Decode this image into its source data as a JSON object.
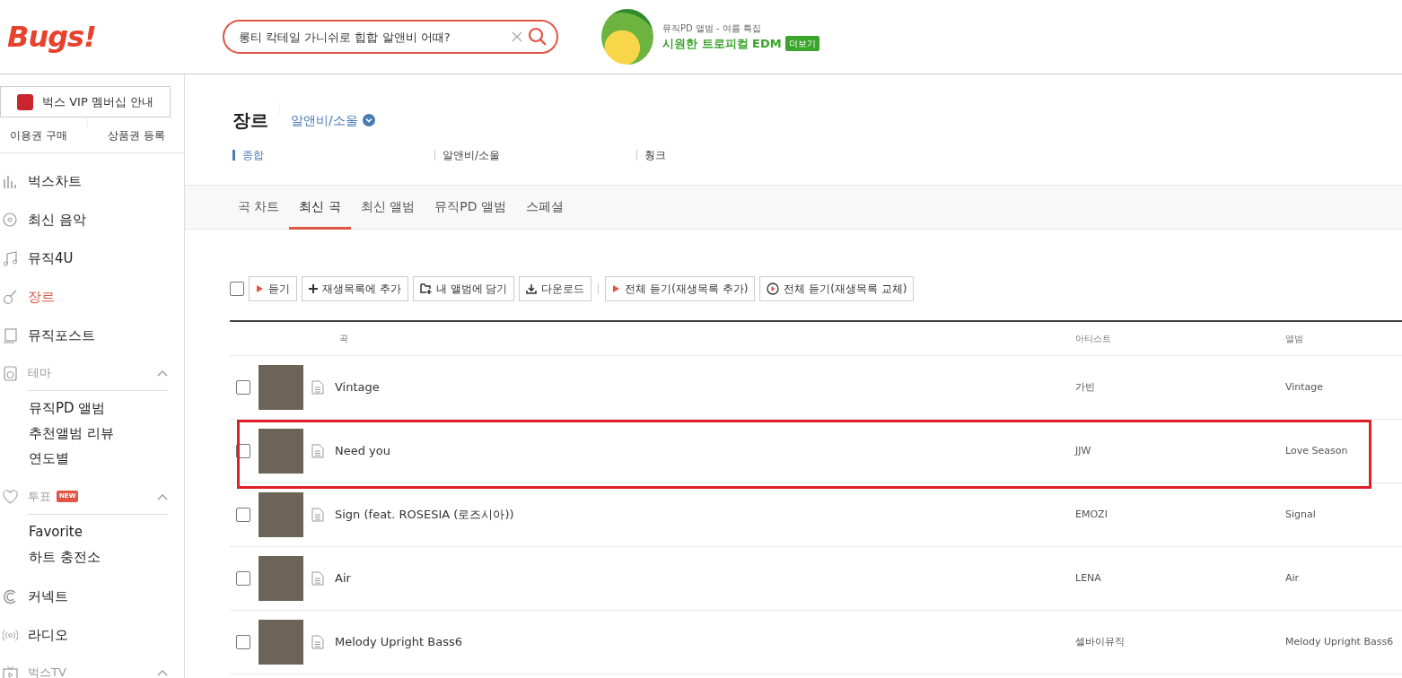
{
  "header": {
    "logo": "Bugs!",
    "search": {
      "placeholder": "롱티 칵테일 가니쉬로 힙합 알앤비 어때?"
    },
    "promo": {
      "caption": "뮤직PD 앨범 - 여름 특집",
      "title": "시원한 트로피컬 EDM",
      "more": "더보기"
    }
  },
  "sidebar": {
    "vip_button": "벅스 VIP 멤버십 안내",
    "links": [
      "이용권 구매",
      "상품권 등록"
    ],
    "items": [
      {
        "kind": "link",
        "label": "벅스차트",
        "selected": false
      },
      {
        "kind": "link",
        "label": "최신 음악",
        "selected": false
      },
      {
        "kind": "link",
        "label": "뮤직4U",
        "selected": false
      },
      {
        "kind": "link",
        "label": "장르",
        "selected": true
      },
      {
        "kind": "link",
        "label": "뮤직포스트",
        "selected": false
      },
      {
        "kind": "section",
        "label": "테마",
        "expanded": true,
        "children": [
          {
            "label": "뮤직PD 앨범"
          },
          {
            "label": "추천앨범 리뷰"
          },
          {
            "label": "연도별"
          }
        ]
      },
      {
        "kind": "section",
        "label": "투표",
        "badge": "NEW",
        "expanded": true,
        "children": [
          {
            "label": "Favorite"
          },
          {
            "label": "하트 충전소"
          }
        ]
      },
      {
        "kind": "link",
        "label": "커넥트",
        "selected": false
      },
      {
        "kind": "link",
        "label": "라디오",
        "selected": false
      },
      {
        "kind": "section",
        "label": "벅스TV",
        "expanded": true
      }
    ]
  },
  "page": {
    "title": "장르",
    "breadcrumb": "알앤비/소울",
    "genres": [
      {
        "label": "종합",
        "selected": true
      },
      {
        "label": "알앤비/소울",
        "selected": false
      },
      {
        "label": "훵크",
        "selected": false
      }
    ],
    "tabs": [
      {
        "label": "곡 차트",
        "selected": false
      },
      {
        "label": "최신 곡",
        "selected": true
      },
      {
        "label": "최신 앨범",
        "selected": false
      },
      {
        "label": "뮤직PD 앨범",
        "selected": false
      },
      {
        "label": "스페셜",
        "selected": false
      }
    ],
    "select_all": {
      "checked": false
    },
    "toolbar": [
      {
        "kind": "play",
        "label": "듣기"
      },
      {
        "kind": "add",
        "label": "재생목록에 추가"
      },
      {
        "kind": "album",
        "label": "내 앨범에 담기"
      },
      {
        "kind": "download",
        "label": "다운로드"
      },
      {
        "kind": "separator"
      },
      {
        "kind": "play",
        "label": "전체 듣기(재생목록 추가)"
      },
      {
        "kind": "replace",
        "label": "전체 듣기(재생목록 교체)"
      }
    ],
    "table": {
      "columns": [
        "곡",
        "아티스트",
        "앨범"
      ],
      "rows": [
        {
          "title": "Vintage",
          "artist": "가빈",
          "album": "Vintage",
          "checked": false,
          "highlighted": false
        },
        {
          "title": "Need you",
          "artist": "JJW",
          "album": "Love Season",
          "checked": false,
          "highlighted": true
        },
        {
          "title": "Sign (feat. ROSESIA (로즈시아))",
          "artist": "EMOZI",
          "album": "Signal",
          "checked": false,
          "highlighted": false
        },
        {
          "title": "Air",
          "artist": "LENA",
          "album": "Air",
          "checked": false,
          "highlighted": false
        },
        {
          "title": "Melody Upright Bass6",
          "artist": "셀바이뮤직",
          "album": "Melody Upright Bass6",
          "checked": false,
          "highlighted": false
        }
      ]
    }
  }
}
